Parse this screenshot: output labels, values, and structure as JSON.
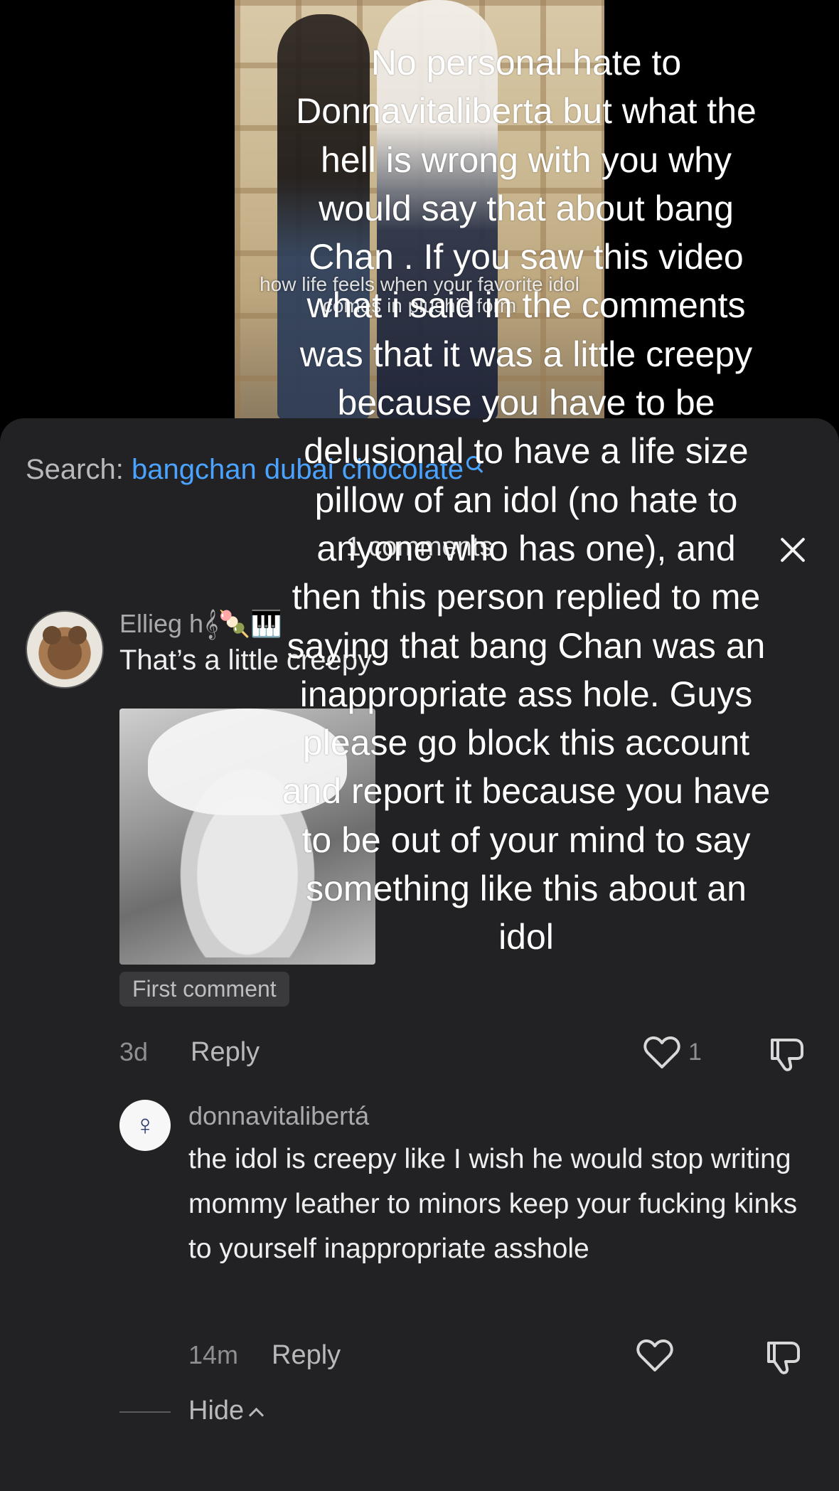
{
  "video": {
    "caption": "how life feels when your favorite idol comes in plushie form"
  },
  "search": {
    "label": "Search:",
    "term": "bangchan dubai chocolate"
  },
  "comments_header": {
    "count_label": "1 comments"
  },
  "comment": {
    "username": "Ellieg h𝄞🍡🎹",
    "text": "That’s a little creepy",
    "badge": "First comment",
    "time": "3d",
    "reply_label": "Reply",
    "likes": "1"
  },
  "reply": {
    "avatar_glyph": "♀",
    "username": "donnavitalibertá",
    "text": "the idol is creepy like I wish he would stop writing mommy leather to minors keep your fucking kinks to yourself inappropriate asshole",
    "time": "14m",
    "reply_label": "Reply"
  },
  "hide": {
    "label": "Hide"
  },
  "overlay": {
    "text": "No personal hate to Donnavitaliberta but what the hell is wrong with you why would say that about bang Chan . If you saw this video what i said in the comments was that it was a little creepy because you have to be delusional to have a life size pillow of an idol (no hate to anyone who has one), and then this person replied to me saying that bang Chan was an inappropriate ass hole. Guys please go block this account and report it because you have to be out of your mind to say something like this about an idol"
  },
  "colors": {
    "sheet_bg": "#222224",
    "search_accent": "#4aa3ff",
    "muted_text": "#8e8e93"
  }
}
